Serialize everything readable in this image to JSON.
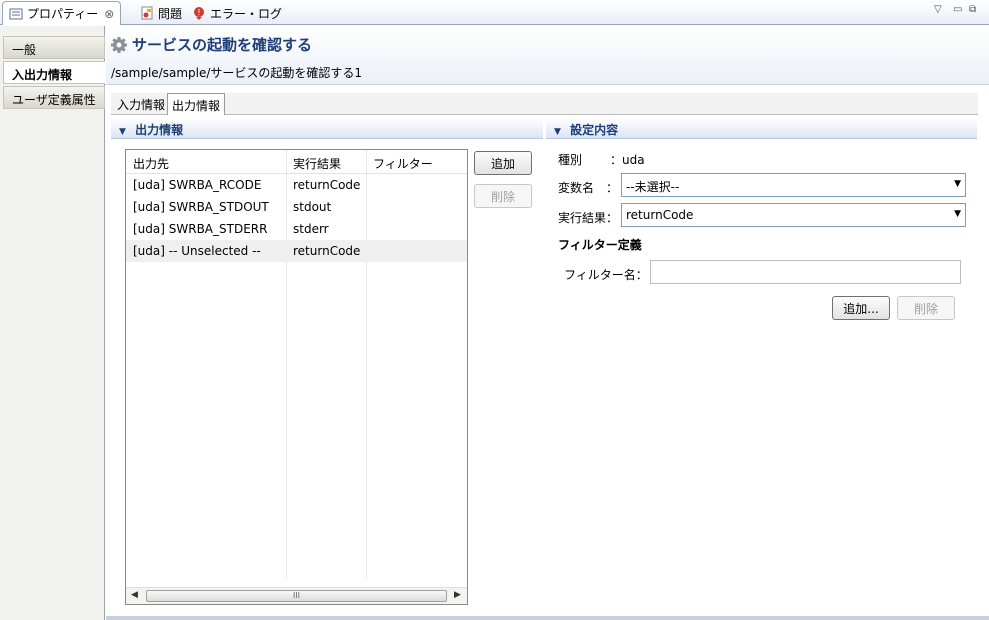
{
  "view_tabs": [
    {
      "label": "プロパティー",
      "icon": "properties-icon",
      "close": "⊗"
    },
    {
      "label": "問題",
      "icon": "problems-icon"
    },
    {
      "label": "エラー・ログ",
      "icon": "error-log-icon"
    }
  ],
  "window_controls": {
    "menu": "▽",
    "minimize": "▭",
    "restore": "⧉"
  },
  "sidebar": {
    "items": [
      {
        "label": "一般"
      },
      {
        "label": "入出力情報"
      },
      {
        "label": "ユーザ定義属性"
      }
    ]
  },
  "header": {
    "title": "サービスの起動を確認する",
    "path": "/sample/sample/サービスの起動を確認する1"
  },
  "subtabs": [
    {
      "label": "入力情報"
    },
    {
      "label": "出力情報"
    }
  ],
  "output_section": {
    "title": "出力情報",
    "columns": [
      "出力先",
      "実行結果",
      "フィルター"
    ],
    "rows": [
      {
        "dest": "[uda] SWRBA_RCODE",
        "result": "returnCode",
        "filter": ""
      },
      {
        "dest": "[uda] SWRBA_STDOUT",
        "result": "stdout",
        "filter": ""
      },
      {
        "dest": "[uda] SWRBA_STDERR",
        "result": "stderr",
        "filter": ""
      },
      {
        "dest": "[uda] -- Unselected --",
        "result": "returnCode",
        "filter": ""
      }
    ],
    "add_label": "追加",
    "delete_label": "削除",
    "scroll_grip": "III"
  },
  "settings_section": {
    "title": "設定内容",
    "type_label": "種別",
    "type_value": "：uda",
    "var_label": "変数名　：",
    "var_value": "--未選択--",
    "result_label": "実行結果：",
    "result_value": "returnCode",
    "filter_def_title": "フィルター定義",
    "filter_name_label": "フィルター名：",
    "filter_name_value": "",
    "add_label": "追加...",
    "delete_label": "削除"
  },
  "colors": {
    "accent": "#1f3f7a",
    "border": "#9aa5b4"
  }
}
